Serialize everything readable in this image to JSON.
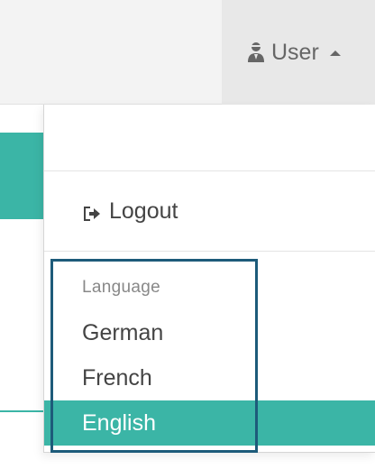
{
  "colors": {
    "accent": "#3bb5a6",
    "highlight_border": "#1d5b7a",
    "topbar": "#f3f3f3"
  },
  "navbar": {
    "user_label": "User",
    "user_icon": "user-secret-icon",
    "caret_icon": "caret-up-icon"
  },
  "dropdown": {
    "logout_label": "Logout",
    "logout_icon": "sign-out-icon",
    "language_header": "Language",
    "languages": [
      "German",
      "French",
      "English"
    ],
    "selected_language": "English"
  }
}
